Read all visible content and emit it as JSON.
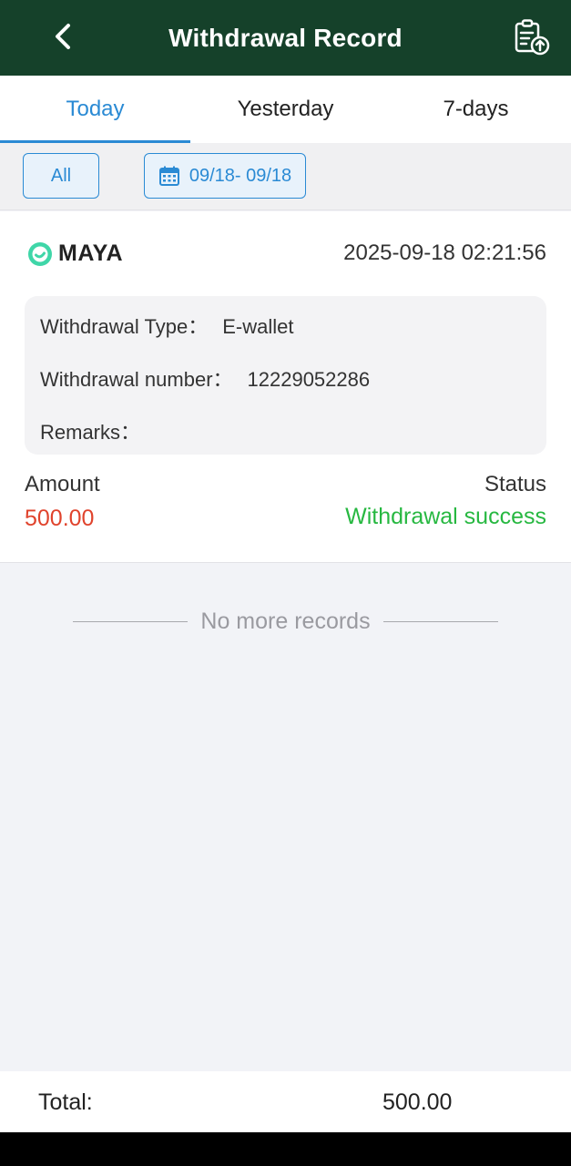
{
  "header": {
    "title": "Withdrawal Record",
    "back_icon": "chevron-left-icon",
    "action_icon": "clipboard-upload-icon",
    "bg_color": "#15412a"
  },
  "tabs": [
    {
      "label": "Today",
      "active": true
    },
    {
      "label": "Yesterday",
      "active": false
    },
    {
      "label": "7-days",
      "active": false
    }
  ],
  "filters": {
    "all_label": "All",
    "date_range": "09/18- 09/18",
    "date_icon": "calendar-icon"
  },
  "record": {
    "provider": "MAYA",
    "datetime": "2025-09-18 02:21:56",
    "type_label": "Withdrawal Type：",
    "type_value": "E-wallet",
    "number_label": "Withdrawal number：",
    "number_value": "12229052286",
    "remarks_label": "Remarks：",
    "remarks_value": "",
    "amount_label": "Amount",
    "amount_value": "500.00",
    "status_label": "Status",
    "status_value": "Withdrawal success",
    "amount_color": "#e0432c",
    "status_color": "#27b841"
  },
  "list_end": "No more records",
  "footer": {
    "total_label": "Total:",
    "total_value": "500.00"
  },
  "accent_color": "#2a8ad4"
}
